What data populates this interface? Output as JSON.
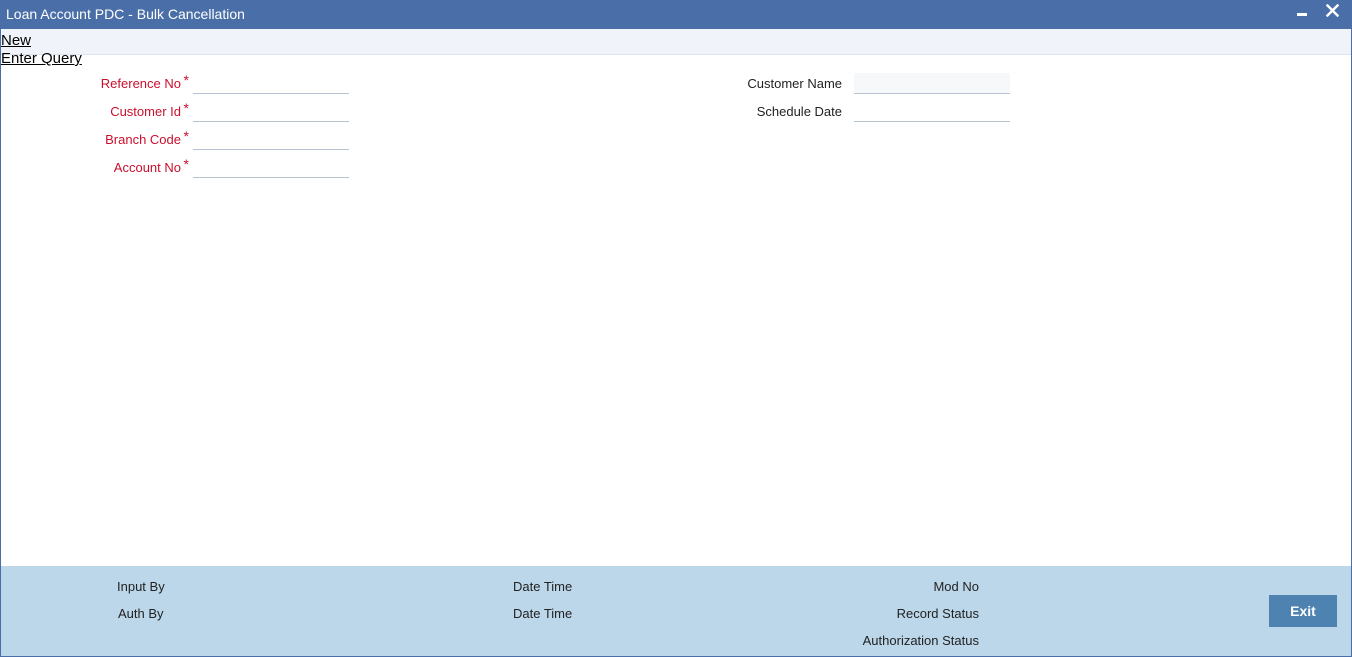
{
  "window": {
    "title": "Loan Account PDC - Bulk Cancellation",
    "minimize_icon": "minimize-icon",
    "close_icon": "close-icon"
  },
  "toolbar": {
    "new_label": "New",
    "enter_query_label": "Enter Query"
  },
  "form": {
    "reference_no": {
      "label": "Reference No",
      "required_mark": "*",
      "value": ""
    },
    "customer_id": {
      "label": "Customer Id",
      "required_mark": "*",
      "value": ""
    },
    "branch_code": {
      "label": "Branch Code",
      "required_mark": "*",
      "value": ""
    },
    "account_no": {
      "label": "Account No",
      "required_mark": "*",
      "value": ""
    },
    "customer_name": {
      "label": "Customer Name",
      "value": ""
    },
    "schedule_date": {
      "label": "Schedule Date",
      "value": ""
    }
  },
  "footer": {
    "input_by": "Input By",
    "auth_by": "Auth By",
    "date_time_1": "Date Time",
    "date_time_2": "Date Time",
    "mod_no": "Mod No",
    "record_status": "Record Status",
    "authorization_status": "Authorization Status",
    "exit_label": "Exit"
  },
  "colors": {
    "titlebar": "#4a6fa8",
    "required_label": "#c8102e",
    "footer_bg": "#bcd7ea",
    "exit_button": "#4e82b1"
  }
}
